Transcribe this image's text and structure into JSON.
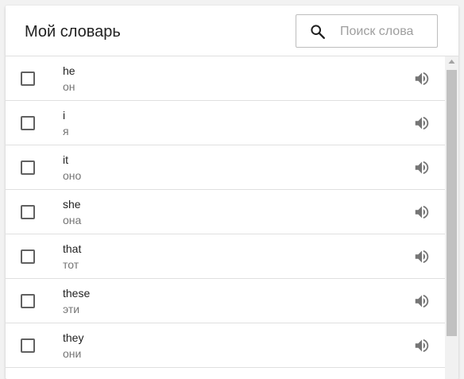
{
  "header": {
    "title": "Мой словарь",
    "search": {
      "placeholder": "Поиск слова",
      "value": "",
      "icon": "search-icon"
    }
  },
  "words": [
    {
      "word": "he",
      "translation": "он",
      "checked": false,
      "icon": "speaker-icon"
    },
    {
      "word": "i",
      "translation": "я",
      "checked": false,
      "icon": "speaker-icon"
    },
    {
      "word": "it",
      "translation": "оно",
      "checked": false,
      "icon": "speaker-icon"
    },
    {
      "word": "she",
      "translation": "она",
      "checked": false,
      "icon": "speaker-icon"
    },
    {
      "word": "that",
      "translation": "тот",
      "checked": false,
      "icon": "speaker-icon"
    },
    {
      "word": "these",
      "translation": "эти",
      "checked": false,
      "icon": "speaker-icon"
    },
    {
      "word": "they",
      "translation": "они",
      "checked": false,
      "icon": "speaker-icon"
    }
  ],
  "colors": {
    "icon": "#757575",
    "divider": "#e0e0e0",
    "text": "#212121",
    "secondary": "#757575"
  }
}
